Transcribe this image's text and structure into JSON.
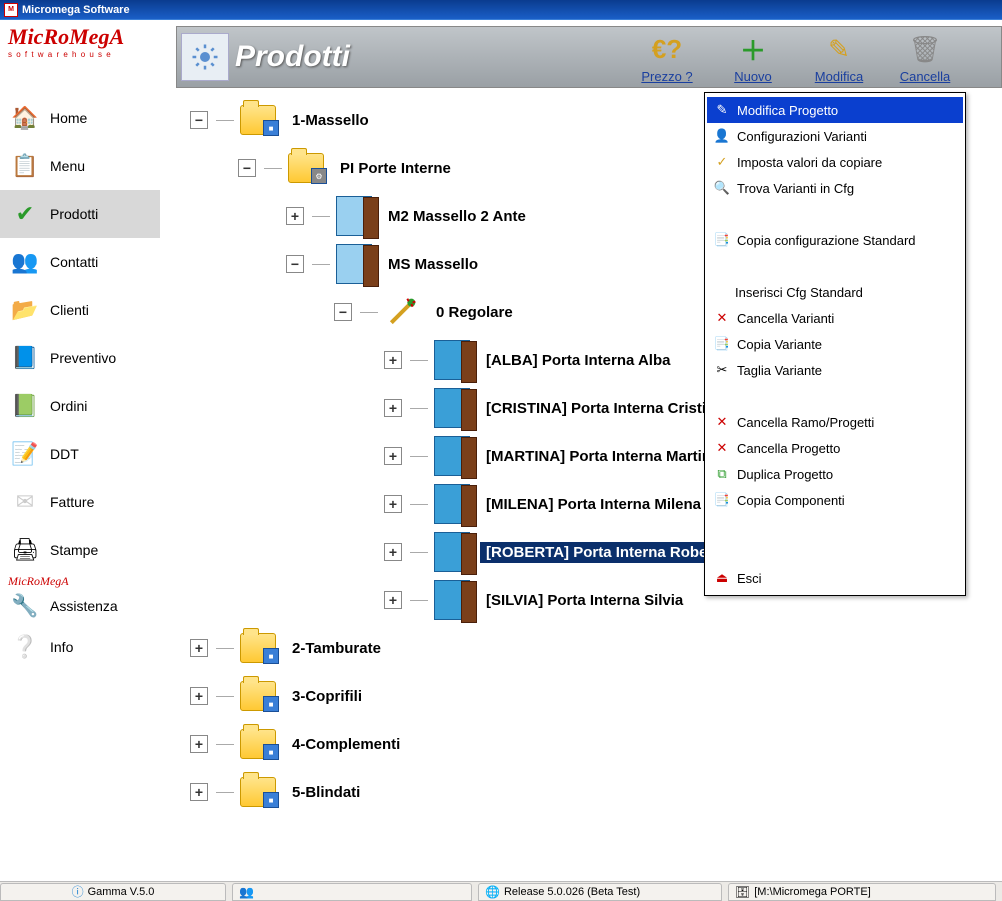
{
  "app_title": "Micromega Software",
  "logo": {
    "text": "MicRoMegA",
    "sub": "s o f t w a r e h o u s e"
  },
  "page_title": "Prodotti",
  "toolbar_actions": {
    "prezzo": "Prezzo ?",
    "nuovo": "Nuovo",
    "modifica": "Modifica",
    "cancella": "Cancella"
  },
  "sidebar": [
    {
      "label": "Home",
      "icon": "🏠"
    },
    {
      "label": "Menu",
      "icon": "📋"
    },
    {
      "label": "Prodotti",
      "icon": "✅",
      "active": true
    },
    {
      "label": "Contatti",
      "icon": "👥"
    },
    {
      "label": "Clienti",
      "icon": "📁"
    },
    {
      "label": "Preventivo",
      "icon": "📘"
    },
    {
      "label": "Ordini",
      "icon": "📗"
    },
    {
      "label": "DDT",
      "icon": "📝"
    },
    {
      "label": "Fatture",
      "icon": "✉"
    },
    {
      "label": "Stampe",
      "icon": "🖨"
    },
    {
      "label": "Assistenza",
      "icon": "🔧"
    },
    {
      "label": "Info",
      "icon": "❓"
    }
  ],
  "tree": {
    "n1": "1-Massello",
    "n1_1": "PI Porte Interne",
    "n1_1_1": "M2 Massello 2 Ante",
    "n1_1_2": "MS Massello",
    "n1_1_2_1": "0 Regolare",
    "leaf_alba": "[ALBA] Porta Interna Alba",
    "leaf_cristina": "[CRISTINA] Porta Interna Cristina",
    "leaf_martina": "[MARTINA] Porta Interna Martina",
    "leaf_milena": "[MILENA] Porta Interna Milena",
    "leaf_roberta": "[ROBERTA] Porta Interna Roberta",
    "leaf_silvia": "[SILVIA] Porta Interna Silvia",
    "n2": "2-Tamburate",
    "n3": "3-Coprifili",
    "n4": "4-Complementi",
    "n5": "5-Blindati"
  },
  "context_menu": {
    "modifica_progetto": "Modifica Progetto",
    "config_varianti": "Configurazioni Varianti",
    "imposta_valori": "Imposta valori da copiare",
    "trova_varianti": "Trova Varianti in Cfg",
    "copia_config_std": "Copia configurazione Standard",
    "inserisci_cfg_std": "Inserisci Cfg Standard",
    "cancella_varianti": "Cancella Varianti",
    "copia_variante": "Copia Variante",
    "taglia_variante": "Taglia Variante",
    "cancella_ramo": "Cancella Ramo/Progetti",
    "cancella_progetto": "Cancella Progetto",
    "duplica_progetto": "Duplica Progetto",
    "copia_componenti": "Copia Componenti",
    "esci": "Esci"
  },
  "statusbar": {
    "gamma": "Gamma V.5.0",
    "release": "Release 5.0.026  (Beta Test)",
    "path": "[M:\\Micromega  PORTE]"
  }
}
